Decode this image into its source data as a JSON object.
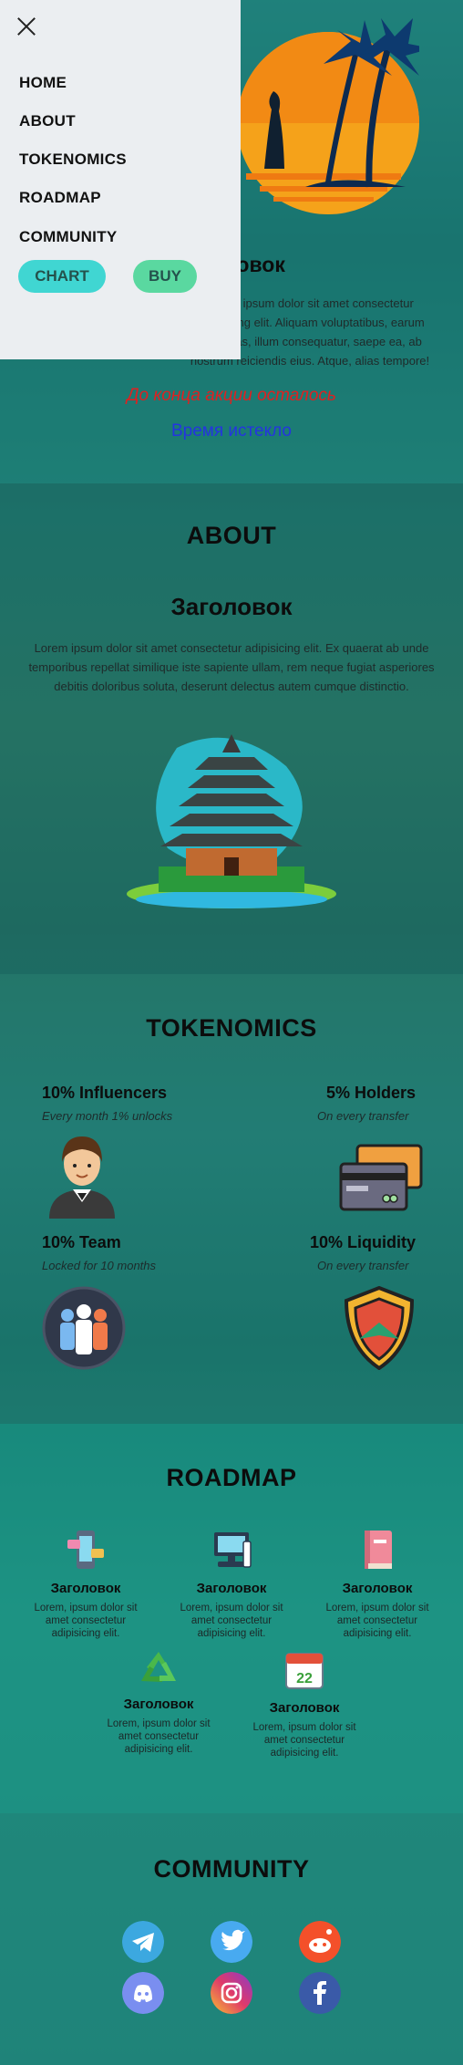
{
  "menu": {
    "items": [
      "HOME",
      "ABOUT",
      "TOKENOMICS",
      "ROADMAP",
      "COMMUNITY"
    ],
    "chart_label": "CHART",
    "buy_label": "BUY"
  },
  "hero": {
    "title": "Заголовок",
    "text": "Lorem ipsum dolor sit amet consectetur adipisicing elit. Aliquam voluptatibus, earum molestias, illum consequatur, saepe ea, ab nostrum reiciendis eius. Atque, alias tempore!",
    "timer_label": "До конца акции осталось",
    "timer_value": "Время истекло"
  },
  "about": {
    "heading": "ABOUT",
    "title": "Заголовок",
    "text": "Lorem ipsum dolor sit amet consectetur adipisicing elit. Ex quaerat ab unde temporibus repellat similique iste sapiente ullam, rem neque fugiat asperiores debitis doloribus soluta, deserunt delectus autem cumque distinctio."
  },
  "tokenomics": {
    "heading": "TOKENOMICS",
    "items": [
      {
        "title": "10% Influencers",
        "sub": "Every month 1% unlocks",
        "icon": "businessman-icon"
      },
      {
        "title": "5% Holders",
        "sub": "On every transfer",
        "icon": "credit-card-icon"
      },
      {
        "title": "10% Team",
        "sub": "Locked for 10 months",
        "icon": "team-icon"
      },
      {
        "title": "10% Liquidity",
        "sub": "On every transfer",
        "icon": "shield-icon"
      }
    ]
  },
  "roadmap": {
    "heading": "ROADMAP",
    "items": [
      {
        "title": "Заголовок",
        "text": "Lorem, ipsum dolor sit amet consectetur adipisicing elit.",
        "icon": "smartphone-chat-icon"
      },
      {
        "title": "Заголовок",
        "text": "Lorem, ipsum dolor sit amet consectetur adipisicing elit.",
        "icon": "computer-icon"
      },
      {
        "title": "Заголовок",
        "text": "Lorem, ipsum dolor sit amet consectetur adipisicing elit.",
        "icon": "book-icon"
      },
      {
        "title": "Заголовок",
        "text": "Lorem, ipsum dolor sit amet consectetur adipisicing elit.",
        "icon": "recycle-icon"
      },
      {
        "title": "Заголовок",
        "text": "Lorem, ipsum dolor sit amet consectetur adipisicing elit.",
        "icon": "calendar-icon"
      }
    ]
  },
  "community": {
    "heading": "COMMUNITY",
    "icons": [
      "telegram-icon",
      "twitter-icon",
      "reddit-icon",
      "discord-icon",
      "instagram-icon",
      "facebook-icon"
    ]
  },
  "colors": {
    "chart_button": "#40d6d2",
    "buy_button": "#5ad8a0",
    "timer_label": "#e02020",
    "timer_value": "#2434e0"
  }
}
